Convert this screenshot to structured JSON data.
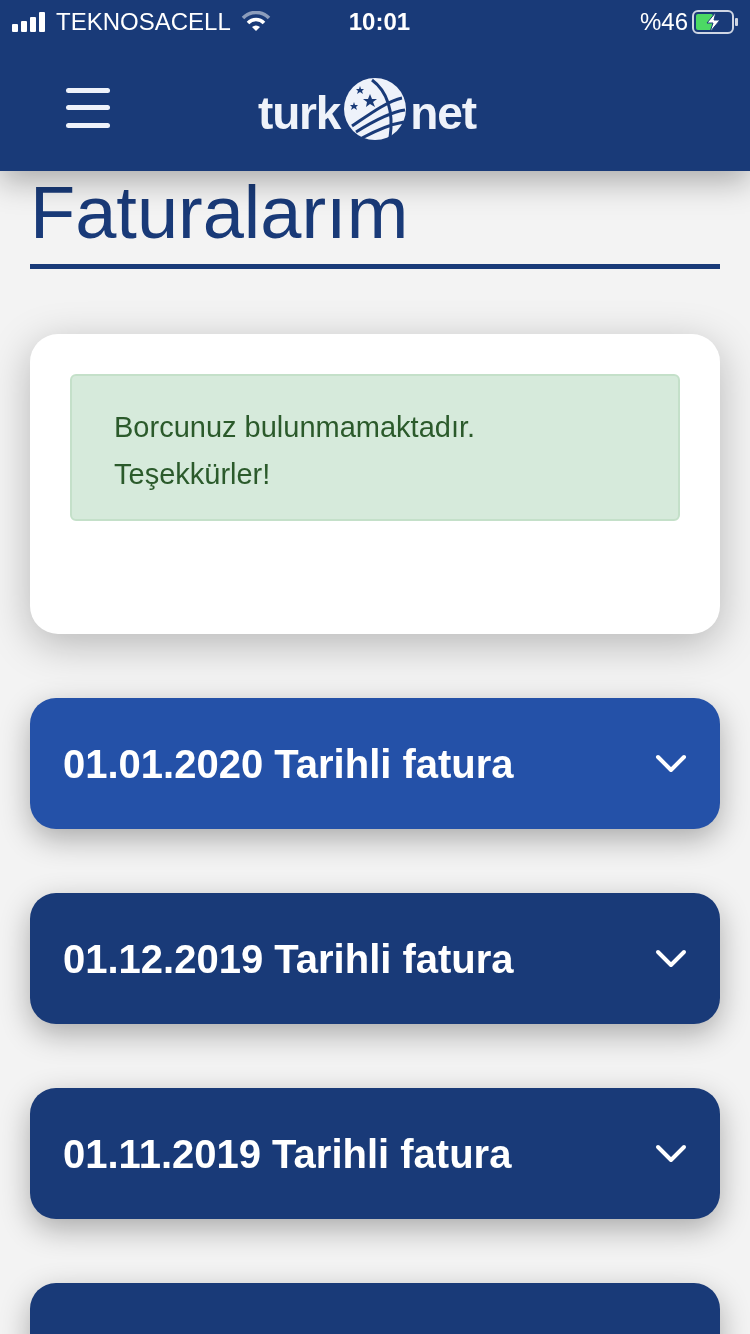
{
  "status_bar": {
    "carrier": "TEKNOSACELL",
    "time": "10:01",
    "battery": "%46",
    "charging": true
  },
  "header": {
    "logo_left": "turk",
    "logo_right": "net"
  },
  "page_title": "Faturalarım",
  "notice": {
    "text": "Borcunuz bulunmamaktadır. Teşekkürler!"
  },
  "invoices": [
    {
      "title": "01.01.2020 Tarihli fatura",
      "selected": true
    },
    {
      "title": "01.12.2019 Tarihli fatura",
      "selected": false
    },
    {
      "title": "01.11.2019 Tarihli fatura",
      "selected": false
    },
    {
      "selected": false
    }
  ]
}
